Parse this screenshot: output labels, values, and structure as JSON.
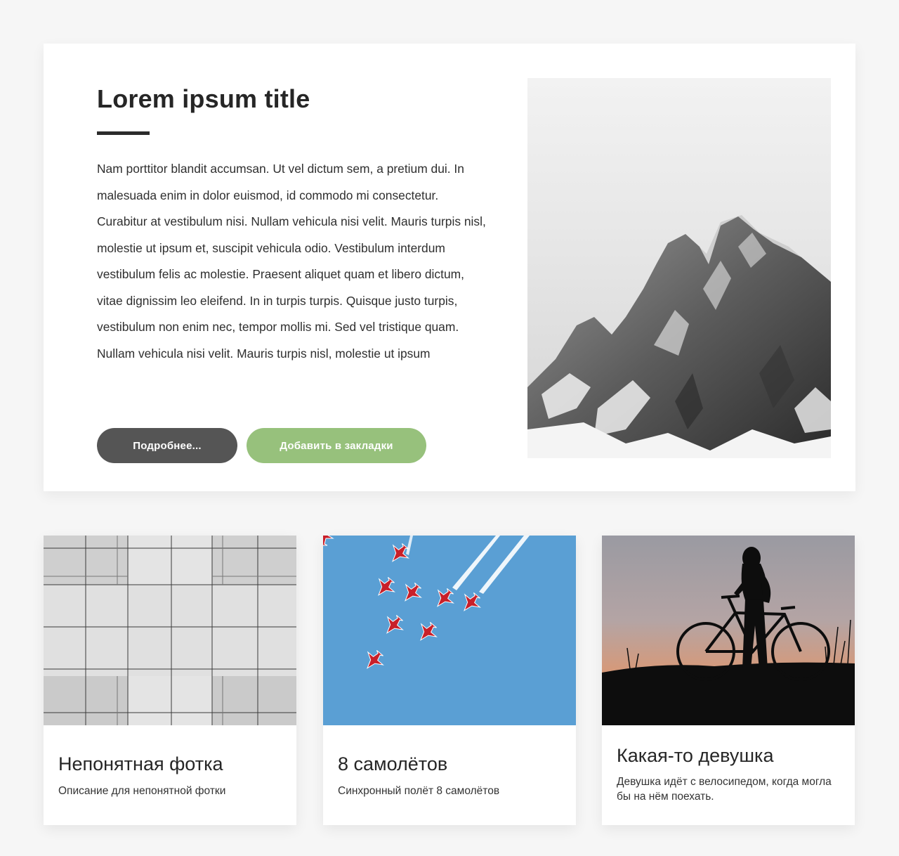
{
  "hero": {
    "title": "Lorem ipsum title",
    "body": "Nam porttitor blandit accumsan. Ut vel dictum sem, a pretium dui. In malesuada enim in dolor euismod, id commodo mi consectetur. Curabitur at vestibulum nisi. Nullam vehicula nisi velit. Mauris turpis nisl, molestie ut ipsum et, suscipit vehicula odio. Vestibulum interdum vestibulum felis ac molestie. Praesent aliquet quam et libero dictum, vitae dignissim leo eleifend. In in turpis turpis. Quisque justo turpis, vestibulum non enim nec, tempor mollis mi. Sed vel tristique quam. Nullam vehicula nisi velit. Mauris turpis nisl, molestie ut ipsum",
    "more_button": "Подробнее...",
    "bookmark_button": "Добавить в закладки",
    "image": "snowy-mountain-photo"
  },
  "cards": [
    {
      "title": "Непонятная фотка",
      "description": "Описание для непонятной фотки",
      "image": "ceiling-tiles-photo"
    },
    {
      "title": "8 самолётов",
      "description": "Синхронный полёт 8 самолётов",
      "image": "jets-formation-photo"
    },
    {
      "title": "Какая-то девушка",
      "description": "Девушка идёт с велосипедом, когда могла бы на нём поехать.",
      "image": "girl-with-bicycle-photo"
    }
  ],
  "colors": {
    "page_background": "#f6f6f6",
    "more_button": "#555555",
    "bookmark_button": "#97c17c",
    "sky_blue": "#5a9fd4"
  }
}
